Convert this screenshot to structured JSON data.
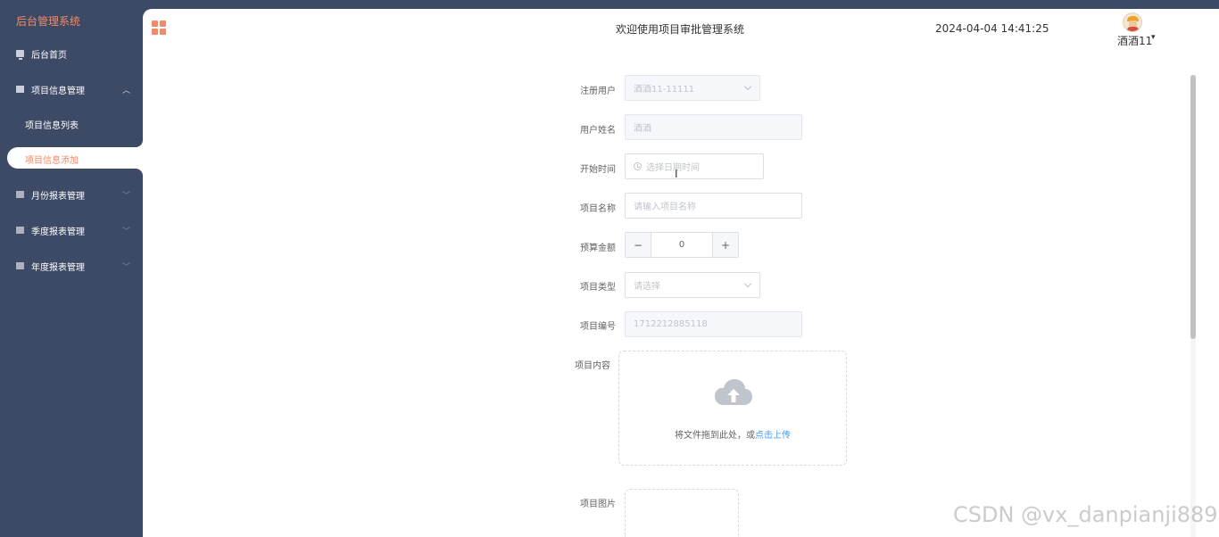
{
  "sidebar": {
    "brand": "后台管理系统",
    "items": [
      {
        "label": "后台首页",
        "icon": "monitor-icon"
      },
      {
        "label": "项目信息管理",
        "icon": "chart-icon",
        "expanded": true,
        "children": [
          {
            "label": "项目信息列表"
          },
          {
            "label": "项目信息添加",
            "active": true
          }
        ]
      },
      {
        "label": "月份报表管理",
        "icon": "chart-icon"
      },
      {
        "label": "季度报表管理",
        "icon": "chart-icon"
      },
      {
        "label": "年度报表管理",
        "icon": "chart-icon"
      }
    ]
  },
  "header": {
    "title": "欢迎使用项目审批管理系统",
    "datetime": "2024-04-04 14:41:25",
    "username": "酒酒11"
  },
  "form": {
    "register_user": {
      "label": "注册用户",
      "value": "酒酒11-11111"
    },
    "user_name": {
      "label": "用户姓名",
      "value": "酒酒"
    },
    "start_time": {
      "label": "开始时间",
      "placeholder": "选择日期时间"
    },
    "project_name": {
      "label": "项目名称",
      "placeholder": "请输入项目名称"
    },
    "budget": {
      "label": "预算金额",
      "value": "0"
    },
    "project_type": {
      "label": "项目类型",
      "placeholder": "请选择"
    },
    "project_number": {
      "label": "项目编号",
      "value": "1712212885118"
    },
    "project_content": {
      "label": "项目内容",
      "upload_text": "将文件拖到此处，或",
      "upload_link": "点击上传"
    },
    "project_image": {
      "label": "项目图片"
    }
  },
  "watermark": "CSDN @vx_danpianji889",
  "colors": {
    "sidebar_bg": "#3d4a66",
    "accent": "#f08a6a",
    "link": "#409eff"
  }
}
